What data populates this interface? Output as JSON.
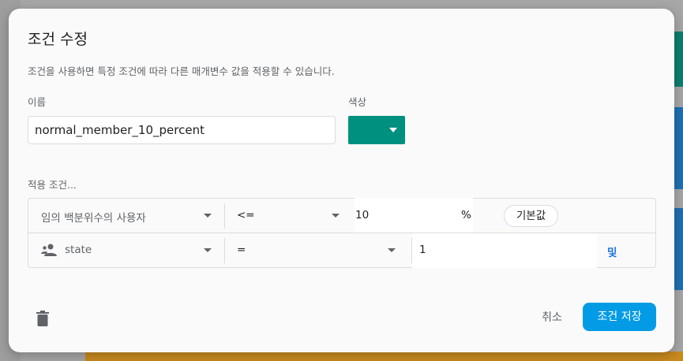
{
  "dialog": {
    "title": "조건 수정",
    "description": "조건을 사용하면 특정 조건에 따라 다른 매개변수 값을 적용할 수 있습니다."
  },
  "name_field": {
    "label": "이름",
    "value": "normal_member_10_percent"
  },
  "color_field": {
    "label": "색상",
    "selected_color": "#009080"
  },
  "conditions": {
    "label": "적용 조건...",
    "rows": [
      {
        "property": "임의 백분위수의 사용자",
        "operator": "<=",
        "value": "10",
        "unit": "%",
        "chip": "기본값"
      },
      {
        "icon": "person-group-icon",
        "property": "state",
        "operator": "=",
        "value": "1",
        "link": "및"
      }
    ]
  },
  "footer": {
    "delete_icon": "trash-icon",
    "cancel_label": "취소",
    "save_label": "조건 저장"
  },
  "colors": {
    "accent": "#039be5",
    "link": "#1a73e8",
    "teal": "#009080"
  }
}
